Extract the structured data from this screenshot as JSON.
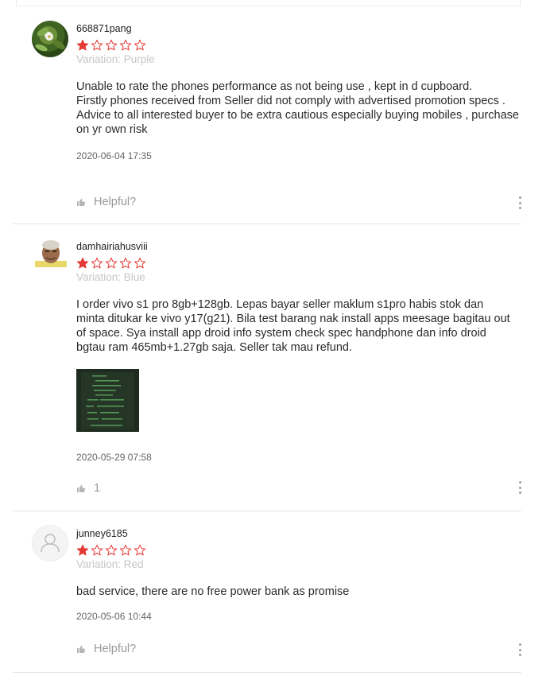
{
  "colors": {
    "star": "#e53935",
    "muted": "#c6c6c6",
    "divider": "#e6e6e6"
  },
  "reviews": [
    {
      "username": "668871pang",
      "rating": 1,
      "max_rating": 5,
      "variation": "Variation: Purple",
      "text": "Unable to rate the phones performance as not being use , kept in d cupboard.\nFirstly phones received from Seller did not comply with advertised promotion specs .\nAdvice to all interested buyer to be extra cautious especially buying mobiles , purchase on yr own risk",
      "timestamp": "2020-06-04 17:35",
      "helpful_label": "Helpful?",
      "avatar_icon": "flower-photo-avatar"
    },
    {
      "username": "damhairiahusviii",
      "rating": 1,
      "max_rating": 5,
      "variation": "Variation: Blue",
      "text": "I order vivo s1 pro 8gb+128gb. Lepas bayar seller maklum s1pro habis stok dan minta ditukar ke vivo y17(g21). Bila test barang nak install apps meesage bagitau out of space. Sya install app droid info system check spec handphone dan info droid bgtau ram 465mb+1.27gb saja. Seller tak mau refund.",
      "timestamp": "2020-05-29 07:58",
      "helpful_label": "1",
      "avatar_icon": "person-photo-avatar"
    },
    {
      "username": "junney6185",
      "rating": 1,
      "max_rating": 5,
      "variation": "Variation: Red",
      "text": "bad service, there are no free power bank as promise",
      "timestamp": "2020-05-06 10:44",
      "helpful_label": "Helpful?",
      "avatar_icon": "default-user-avatar"
    }
  ]
}
